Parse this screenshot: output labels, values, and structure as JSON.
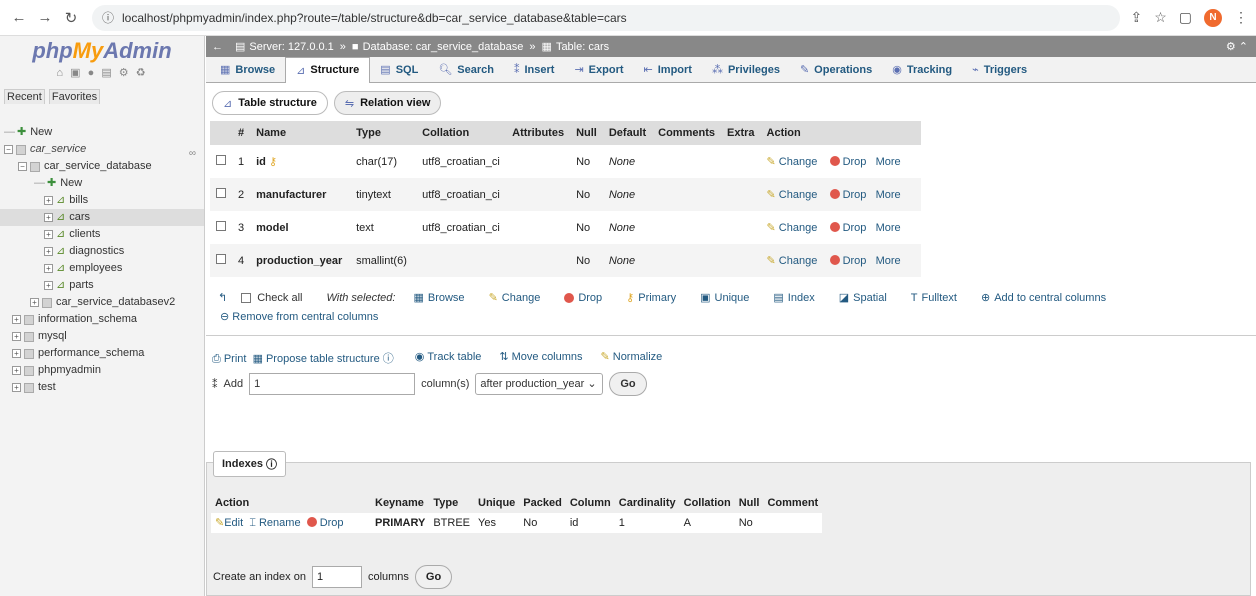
{
  "browser": {
    "url": "localhost/phpmyadmin/index.php?route=/table/structure&db=car_service_database&table=cars",
    "avatar_letter": "N"
  },
  "sidebar": {
    "logo": {
      "php": "php",
      "my": "My",
      "admin": "Admin"
    },
    "tabs": [
      "Recent",
      "Favorites"
    ],
    "tree": {
      "new_root": "New",
      "car_service": "car_service",
      "car_service_database": "car_service_database",
      "db_new": "New",
      "tables": [
        "bills",
        "cars",
        "clients",
        "diagnostics",
        "employees",
        "parts"
      ],
      "car_service_databasev2": "car_service_databasev2",
      "others": [
        "information_schema",
        "mysql",
        "performance_schema",
        "phpmyadmin",
        "test"
      ]
    }
  },
  "breadcrumb": {
    "server": "Server: 127.0.0.1",
    "database": "Database: car_service_database",
    "table": "Table: cars"
  },
  "tabs": [
    "Browse",
    "Structure",
    "SQL",
    "Search",
    "Insert",
    "Export",
    "Import",
    "Privileges",
    "Operations",
    "Tracking",
    "Triggers"
  ],
  "subtabs": {
    "structure": "Table structure",
    "relation": "Relation view"
  },
  "structure": {
    "headers": [
      "#",
      "Name",
      "Type",
      "Collation",
      "Attributes",
      "Null",
      "Default",
      "Comments",
      "Extra",
      "Action"
    ],
    "rows": [
      {
        "num": "1",
        "name": "id",
        "type": "char(17)",
        "collation": "utf8_croatian_ci",
        "attributes": "",
        "null": "No",
        "default": "None",
        "comments": "",
        "extra": ""
      },
      {
        "num": "2",
        "name": "manufacturer",
        "type": "tinytext",
        "collation": "utf8_croatian_ci",
        "attributes": "",
        "null": "No",
        "default": "None",
        "comments": "",
        "extra": ""
      },
      {
        "num": "3",
        "name": "model",
        "type": "text",
        "collation": "utf8_croatian_ci",
        "attributes": "",
        "null": "No",
        "default": "None",
        "comments": "",
        "extra": ""
      },
      {
        "num": "4",
        "name": "production_year",
        "type": "smallint(6)",
        "collation": "",
        "attributes": "",
        "null": "No",
        "default": "None",
        "comments": "",
        "extra": ""
      }
    ],
    "actions": {
      "change": "Change",
      "drop": "Drop",
      "more": "More"
    }
  },
  "with_selected": {
    "check_all": "Check all",
    "label": "With selected:",
    "items": [
      "Browse",
      "Change",
      "Drop",
      "Primary",
      "Unique",
      "Index",
      "Spatial",
      "Fulltext",
      "Add to central columns"
    ],
    "remove_central": "Remove from central columns"
  },
  "tools": {
    "print": "Print",
    "propose": "Propose table structure",
    "track": "Track table",
    "move": "Move columns",
    "normalize": "Normalize"
  },
  "add_columns": {
    "label": "Add",
    "count": "1",
    "unit": "column(s)",
    "position": "after production_year",
    "go": "Go"
  },
  "indexes": {
    "legend": "Indexes",
    "headers": [
      "Action",
      "Keyname",
      "Type",
      "Unique",
      "Packed",
      "Column",
      "Cardinality",
      "Collation",
      "Null",
      "Comment"
    ],
    "row": {
      "edit": "Edit",
      "rename": "Rename",
      "drop": "Drop",
      "keyname": "PRIMARY",
      "type": "BTREE",
      "unique": "Yes",
      "packed": "No",
      "column": "id",
      "cardinality": "1",
      "collation": "A",
      "null": "No",
      "comment": ""
    },
    "create_label": "Create an index on",
    "create_count": "1",
    "create_unit": "columns",
    "go": "Go"
  }
}
